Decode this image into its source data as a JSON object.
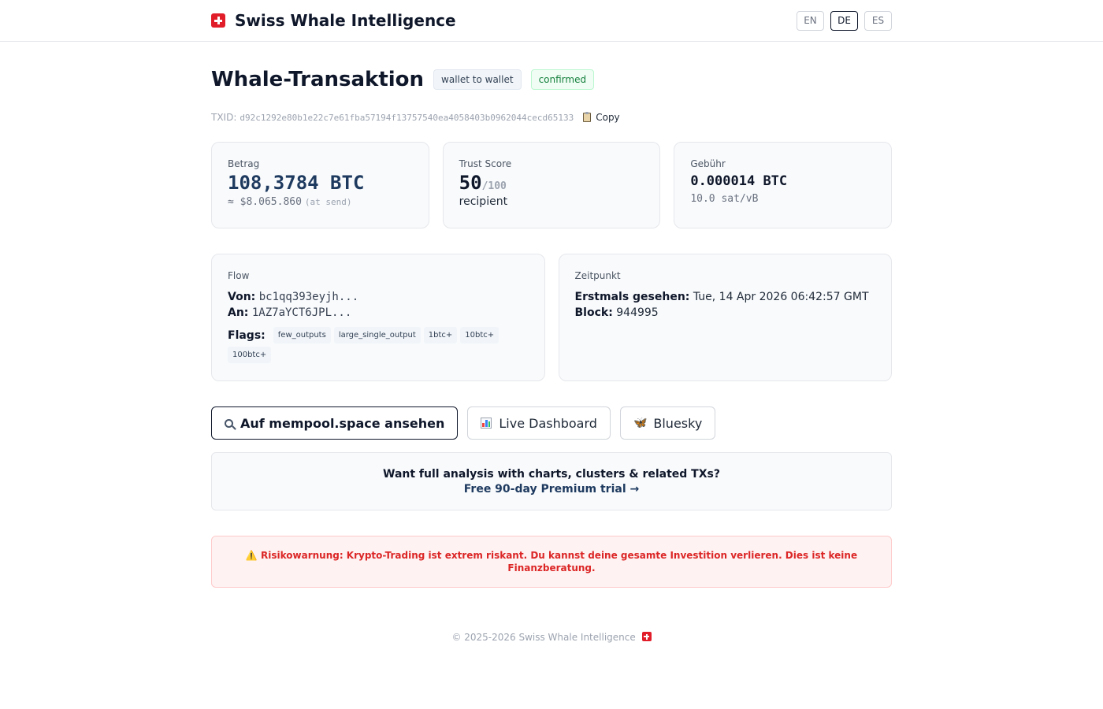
{
  "header": {
    "brand": "Swiss Whale Intelligence",
    "languages": [
      "EN",
      "DE",
      "ES"
    ],
    "active_language": "DE"
  },
  "title": {
    "heading": "Whale-Transaktion",
    "type_badge": "wallet to wallet",
    "status_badge": "confirmed"
  },
  "txid": {
    "label": "TXID:",
    "value": "d92c1292e80b1e22c7e61fba57194f13757540ea4058403b0962044cecd65133",
    "copy_label": "Copy"
  },
  "amount": {
    "label": "Betrag",
    "value": "108,3784 BTC",
    "usd": "≈ $8.065.860",
    "usd_note": "(at send)"
  },
  "trust": {
    "label": "Trust Score",
    "score": "50",
    "max": "/100",
    "role": "recipient"
  },
  "fee": {
    "label": "Gebühr",
    "value": "0.000014 BTC",
    "rate": "10.0 sat/vB"
  },
  "flow": {
    "label": "Flow",
    "from_label": "Von:",
    "from": "bc1qq393eyjh...",
    "to_label": "An:",
    "to": "1AZ7aYCT6JPL...",
    "flags_label": "Flags:",
    "flags": [
      "few_outputs",
      "large_single_output",
      "1btc+",
      "10btc+",
      "100btc+"
    ]
  },
  "time": {
    "label": "Zeitpunkt",
    "first_seen_label": "Erstmals gesehen:",
    "first_seen": "Tue, 14 Apr 2026 06:42:57 GMT",
    "block_label": "Block:",
    "block": "944995"
  },
  "buttons": {
    "mempool": "Auf mempool.space ansehen",
    "dashboard": "Live Dashboard",
    "bluesky": "Bluesky"
  },
  "promo": {
    "question": "Want full analysis with charts, clusters & related TXs?",
    "link": "Free 90-day Premium trial →"
  },
  "risk": {
    "text": "⚠️ Risikowarnung: Krypto-Trading ist extrem riskant. Du kannst deine gesamte Investition verlieren. Dies ist keine Finanzberatung."
  },
  "footer": {
    "text": "© 2025-2026 Swiss Whale Intelligence"
  },
  "icons": {
    "flag": "swiss-flag-icon",
    "copy": "clipboard-icon",
    "mempool": "magnifier-icon",
    "dashboard": "bar-chart-icon",
    "bluesky": "butterfly-icon"
  }
}
